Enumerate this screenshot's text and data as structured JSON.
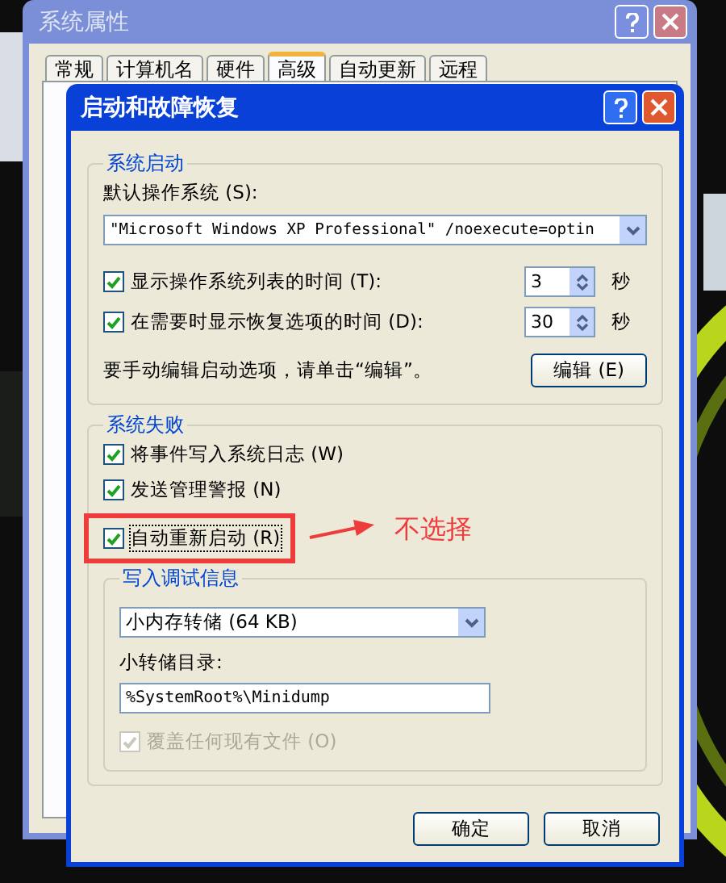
{
  "back_window": {
    "title": "系统属性",
    "tabs": [
      {
        "label": "常规",
        "selected": false
      },
      {
        "label": "计算机名",
        "selected": false
      },
      {
        "label": "硬件",
        "selected": false
      },
      {
        "label": "高级",
        "selected": true
      },
      {
        "label": "自动更新",
        "selected": false
      },
      {
        "label": "远程",
        "selected": false
      }
    ]
  },
  "dialog": {
    "title": "启动和故障恢复",
    "startup": {
      "title": "系统启动",
      "default_os_label": "默认操作系统 (S):",
      "default_os": "\"Microsoft Windows XP Professional\" /noexecute=optin",
      "timers": [
        {
          "label": "显示操作系统列表的时间 (T):",
          "checked": true,
          "value": "3",
          "unit": "秒"
        },
        {
          "label": "在需要时显示恢复选项的时间 (D):",
          "checked": true,
          "value": "30",
          "unit": "秒"
        }
      ],
      "edit_hint": "要手动编辑启动选项，请单击“编辑”。",
      "edit_button": "编辑 (E)"
    },
    "failure": {
      "title": "系统失败",
      "options": [
        {
          "label": "将事件写入系统日志 (W)",
          "checked": true,
          "focused": false
        },
        {
          "label": "发送管理警报 (N)",
          "checked": true,
          "focused": false
        },
        {
          "label": "自动重新启动 (R)",
          "checked": true,
          "focused": true
        }
      ],
      "debug": {
        "title": "写入调试信息",
        "dump_type": "小内存转储 (64 KB)",
        "dir_label": "小转储目录:",
        "dir": "%SystemRoot%\\Minidump",
        "overwrite": {
          "label": "覆盖任何现有文件 (O)",
          "checked": true,
          "disabled": true
        }
      }
    },
    "buttons": [
      "确定",
      "取消"
    ]
  },
  "annotation": {
    "text": "不选择"
  }
}
